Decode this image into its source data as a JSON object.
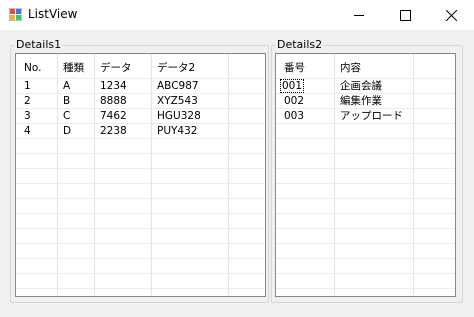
{
  "window": {
    "title": "ListView"
  },
  "details1": {
    "label": "Details1",
    "headers": [
      "No.",
      "種類",
      "データ",
      "データ2"
    ],
    "rows": [
      [
        "1",
        "A",
        "1234",
        "ABC987"
      ],
      [
        "2",
        "B",
        "8888",
        "XYZ543"
      ],
      [
        "3",
        "C",
        "7462",
        "HGU328"
      ],
      [
        "4",
        "D",
        "2238",
        "PUY432"
      ]
    ]
  },
  "details2": {
    "label": "Details2",
    "headers": [
      "番号",
      "内容"
    ],
    "rows": [
      [
        "001",
        "企画会議"
      ],
      [
        "002",
        "編集作業"
      ],
      [
        "003",
        "アップロード"
      ]
    ]
  },
  "colors": {
    "window_bg": "#f0f0f0",
    "titlebar_bg": "#ffffff",
    "grid_line": "#e5e5e5",
    "listview_border": "#828790"
  }
}
